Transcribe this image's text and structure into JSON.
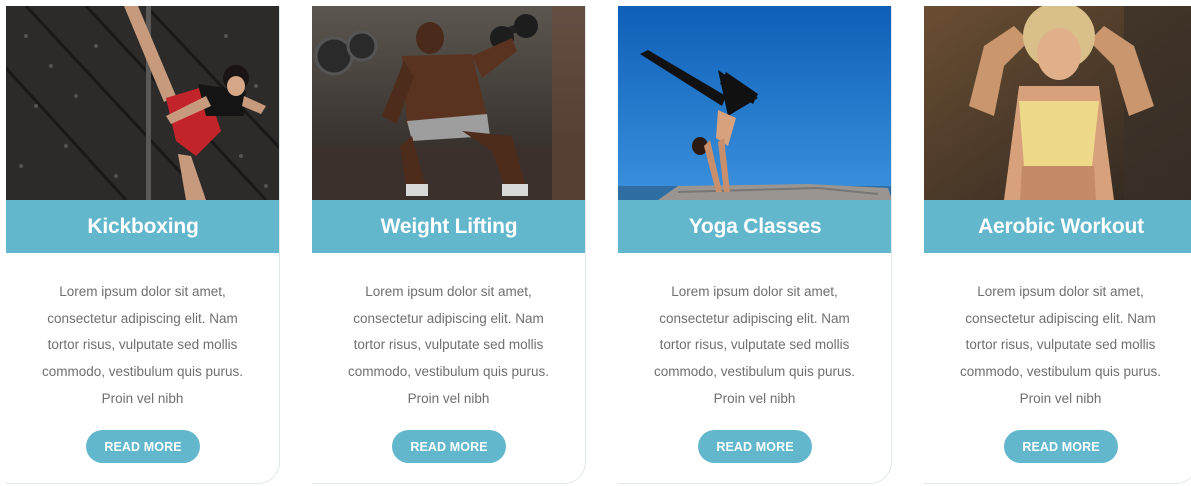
{
  "cards": [
    {
      "title": "Kickboxing",
      "description": "Lorem ipsum dolor sit amet, consectetur adipiscing elit. Nam tortor risus, vulputate sed mollis commodo, vestibulum quis purus. Proin vel nibh",
      "button_label": "READ MORE"
    },
    {
      "title": "Weight Lifting",
      "description": "Lorem ipsum dolor sit amet, consectetur adipiscing elit. Nam tortor risus, vulputate sed mollis commodo, vestibulum quis purus. Proin vel nibh",
      "button_label": "READ MORE"
    },
    {
      "title": "Yoga Classes",
      "description": "Lorem ipsum dolor sit amet, consectetur adipiscing elit. Nam tortor risus, vulputate sed mollis commodo, vestibulum quis purus. Proin vel nibh",
      "button_label": "READ MORE"
    },
    {
      "title": "Aerobic Workout",
      "description": "Lorem ipsum dolor sit amet, consectetur adipiscing elit. Nam tortor risus, vulputate sed mollis commodo, vestibulum quis purus. Proin vel nibh",
      "button_label": "READ MORE"
    }
  ],
  "colors": {
    "accent": "#62b7cc",
    "body_text": "#6f6f6f",
    "button_text": "#ffffff"
  }
}
